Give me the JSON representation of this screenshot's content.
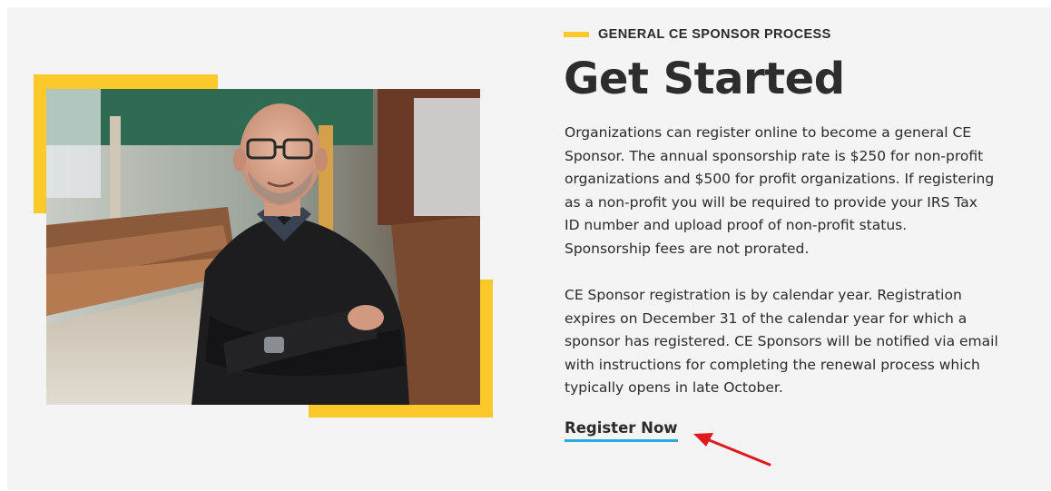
{
  "section": {
    "eyebrow": "GENERAL CE SPONSOR PROCESS",
    "title": "Get Started",
    "paragraph1": [
      "Organizations can register online to become a general CE",
      "Sponsor. The annual sponsorship rate is $250 for non-profit",
      "organizations and $500 for profit organizations. If registering",
      "as a non-profit you will be required to provide your IRS Tax",
      "ID number and upload proof of non-profit status.",
      "Sponsorship fees are not prorated."
    ],
    "paragraph2": [
      "CE Sponsor registration is by calendar year. Registration",
      "expires on December 31 of the calendar year for which a",
      "sponsor has registered. CE Sponsors will be notified via email",
      "with instructions for completing the renewal process which",
      "typically opens in late October."
    ],
    "cta_label": "Register Now"
  },
  "colors": {
    "accent_yellow": "#fbc92a",
    "link_underline": "#29a9e0",
    "annotation_arrow": "#e0191f",
    "background": "#f4f4f4",
    "text": "#2b2b2b"
  },
  "icons": {
    "annotation": "red-arrow-icon"
  }
}
